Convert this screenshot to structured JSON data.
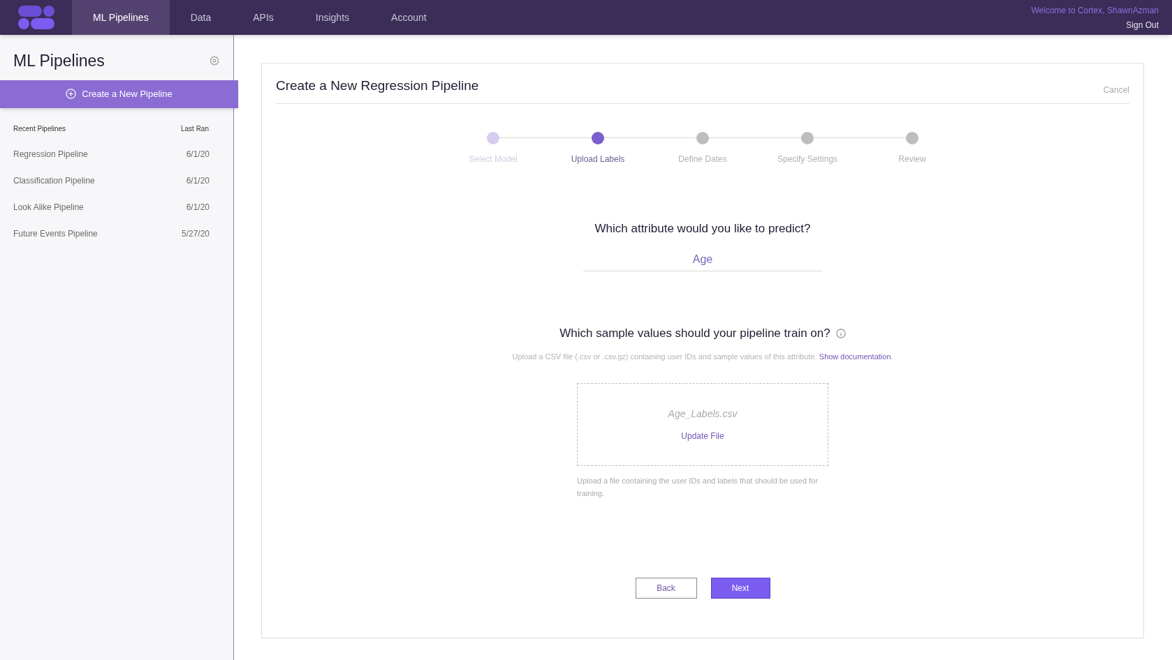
{
  "nav": {
    "tabs": [
      {
        "label": "ML Pipelines",
        "selected": true
      },
      {
        "label": "Data",
        "selected": false
      },
      {
        "label": "APIs",
        "selected": false
      },
      {
        "label": "Insights",
        "selected": false
      },
      {
        "label": "Account",
        "selected": false
      }
    ],
    "welcome": "Welcome to Cortex, ShawnAzman",
    "sign_out": "Sign Out"
  },
  "sidebar": {
    "title": "ML Pipelines",
    "create_button": "Create a New Pipeline",
    "columns": [
      "Recent Pipelines",
      "Last Ran"
    ],
    "items": [
      {
        "name": "Regression Pipeline",
        "last_ran": "6/1/20"
      },
      {
        "name": "Classification Pipeline",
        "last_ran": "6/1/20"
      },
      {
        "name": "Look Alike Pipeline",
        "last_ran": "6/1/20"
      },
      {
        "name": "Future Events Pipeline",
        "last_ran": "5/27/20"
      }
    ]
  },
  "form": {
    "title": "Create a New Regression Pipeline",
    "cancel": "Cancel",
    "steps": [
      {
        "label": "Select Model",
        "completed": true,
        "selected": false
      },
      {
        "label": "Upload Labels",
        "completed": false,
        "selected": true
      },
      {
        "label": "Define Dates",
        "completed": false,
        "selected": false
      },
      {
        "label": "Specify Settings",
        "completed": false,
        "selected": false
      },
      {
        "label": "Review",
        "completed": false,
        "selected": false
      }
    ],
    "question": "Which attribute would you like to predict?",
    "attribute_value": "Age",
    "sample_question": "Which sample values should your pipeline train on?",
    "description": {
      "text": "Upload a CSV file (.csv or .csv.gz) containing user IDs and sample values of this attribute.",
      "link": "Show documentation",
      "after": "."
    },
    "file_name": "Age_Labels.csv",
    "update_file": "Update File",
    "help": "Upload a file containing the user IDs and labels that should be used for training.",
    "buttons": {
      "back": "Back",
      "next": "Next"
    }
  }
}
